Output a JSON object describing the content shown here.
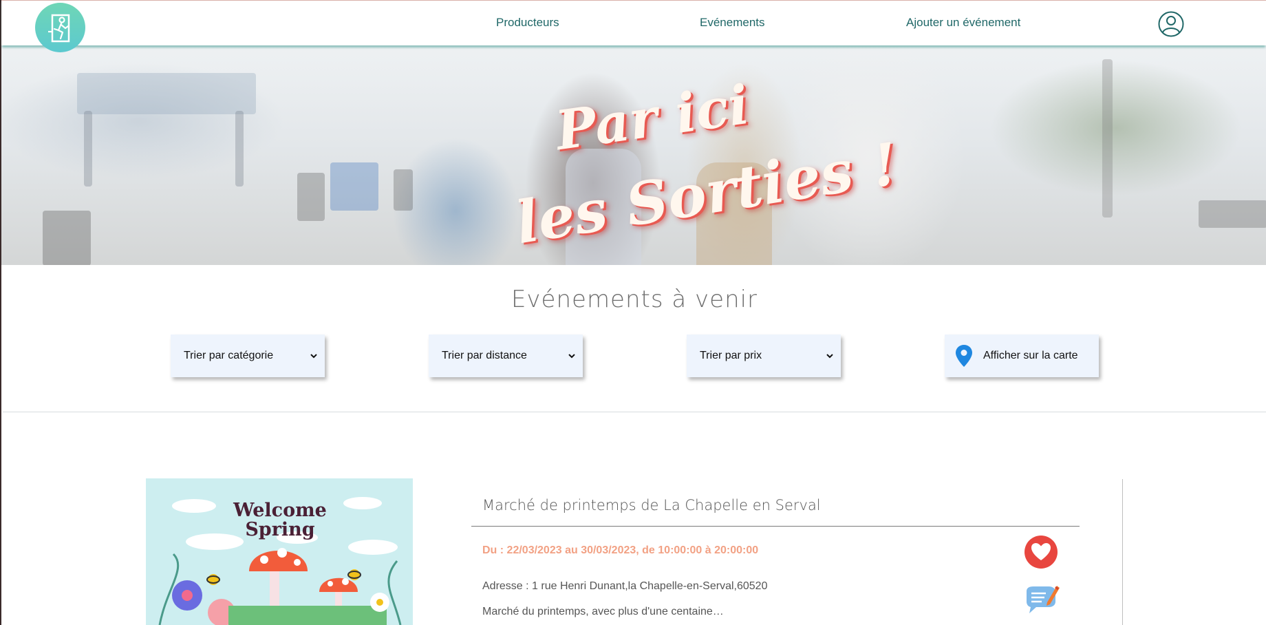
{
  "header": {
    "logo_icon": "exit-door-person-icon",
    "nav": [
      {
        "label": "Producteurs"
      },
      {
        "label": "Evénements"
      },
      {
        "label": "Ajouter un événement"
      }
    ],
    "user_icon": "user-account-icon"
  },
  "hero": {
    "title_line1": "Par ici",
    "title_line2": "les Sorties !"
  },
  "filters": {
    "title": "Evénements à venir",
    "category": {
      "selected": "Trier par catégorie"
    },
    "distance": {
      "selected": "Trier par distance"
    },
    "price": {
      "selected": "Trier par prix"
    },
    "map_button": {
      "label": "Afficher sur la carte",
      "icon": "map-pin-icon"
    }
  },
  "event": {
    "image": {
      "heading_line1": "Welcome",
      "heading_line2": "Spring"
    },
    "title": "Marché de printemps de La Chapelle en Serval",
    "dates": "Du : 22/03/2023 au 30/03/2023, de 10:00:00 à 20:00:00",
    "address": "Adresse : 1 rue Henri Dunant,la Chapelle-en-Serval,60520",
    "description": "Marché du printemps, avec plus d'une centaine…",
    "favorite_icon": "heart-icon",
    "comment_icon": "comment-edit-icon"
  },
  "colors": {
    "nav_text": "#1f6767",
    "accent_teal": "#5cc9cf",
    "date_text": "#f2a184",
    "favorite_red": "#e8463f",
    "filter_bg": "#eef4fd"
  }
}
